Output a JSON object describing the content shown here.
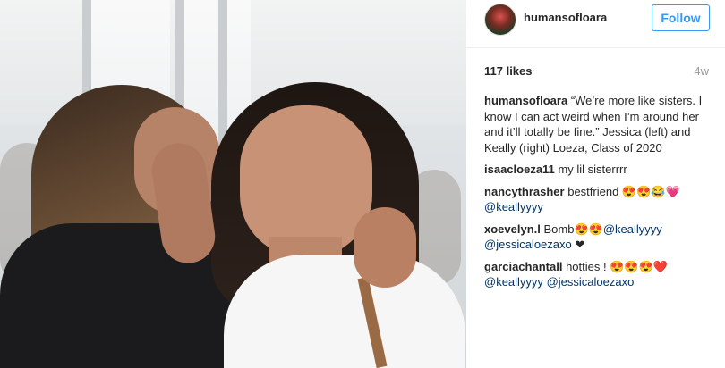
{
  "photo": {
    "alt_icon": "photo"
  },
  "header": {
    "username": "humansofloara",
    "follow_label": "Follow"
  },
  "stats": {
    "likes": "117 likes",
    "age": "4w"
  },
  "caption": {
    "username": "humansofloara",
    "text": "“We’re more like sisters. I know I can act weird when I’m around her and it’ll totally be fine.” Jessica (left) and Keally (right) Loeza, Class of 2020"
  },
  "comments": [
    {
      "username": "isaacloeza11",
      "text": "my lil sisterrrr",
      "mentions": []
    },
    {
      "username": "nancythrasher",
      "text": "bestfriend 😍😍😂💗",
      "mentions": [
        "@keallyyyy"
      ]
    },
    {
      "username": "xoevelyn.l",
      "text": "Bomb😍😍",
      "mentions": [
        "@keallyyyy",
        "@jessicaloezaxo"
      ],
      "suffix": "❤"
    },
    {
      "username": "garciachantall",
      "text": "hotties ! 😍😍😍❤️",
      "mentions": [
        "@keallyyyy",
        "@jessicaloezaxo"
      ]
    }
  ],
  "colors": {
    "accent": "#3897f0",
    "mention": "#003569",
    "text": "#262626",
    "muted": "#999999"
  }
}
